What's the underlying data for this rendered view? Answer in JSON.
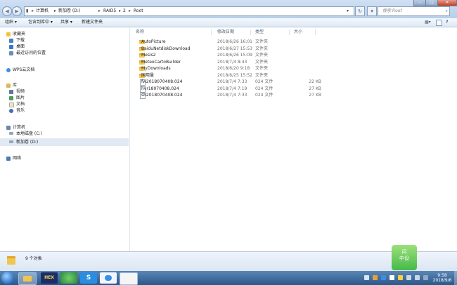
{
  "address": {
    "segments": [
      "计算机",
      "新加卷 (D:)",
      "RAID5",
      "2",
      "Root"
    ]
  },
  "search": {
    "placeholder": "搜索 Root"
  },
  "toolbar": {
    "organize": "组织 ▾",
    "include_in_library": "包含到库中 ▾",
    "share": "共享 ▾",
    "new_folder": "新建文件夹"
  },
  "nav": {
    "favorites": "收藏夹",
    "downloads": "下载",
    "desktop": "桌面",
    "recent": "最近访问的位置",
    "wps_cloud": "WPS云文档",
    "libraries": "库",
    "videos": "视频",
    "pictures": "图片",
    "documents": "文档",
    "music": "音乐",
    "computer": "计算机",
    "local_disk": "本地磁盘 (C:)",
    "new_volume": "新加卷 (D:)",
    "network": "网络"
  },
  "columns": {
    "name": "名称",
    "modified": "修改日期",
    "type": "类型",
    "size": "大小"
  },
  "files": [
    {
      "name": "AutoPicture",
      "modified": "2018/6/26 16:01",
      "type": "文件夹",
      "size": "",
      "kind": "folder"
    },
    {
      "name": "BaiduNetdiskDownload",
      "modified": "2018/6/27 15:53",
      "type": "文件夹",
      "size": "",
      "kind": "folder"
    },
    {
      "name": "Mesis2",
      "modified": "2018/6/26 15:09",
      "type": "文件夹",
      "size": "",
      "kind": "folder"
    },
    {
      "name": "MeteoCartoBuilder",
      "modified": "2018/7/4 8:43",
      "type": "文件夹",
      "size": "",
      "kind": "folder"
    },
    {
      "name": "MyDownloads",
      "modified": "2018/6/20 9:18",
      "type": "文件夹",
      "size": "",
      "kind": "folder"
    },
    {
      "name": "国用量",
      "modified": "2018/6/25 15:52",
      "type": "文件夹",
      "size": "",
      "kind": "folder"
    },
    {
      "name": "fw2018070408.024",
      "modified": "2018/7/4 7:33",
      "type": "024 文件",
      "size": "22 KB",
      "kind": "file"
    },
    {
      "name": "hvr18070408.024",
      "modified": "2018/7/4 7:19",
      "type": "024 文件",
      "size": "27 KB",
      "kind": "file"
    },
    {
      "name": "sh2018070408.024",
      "modified": "2018/7/4 7:33",
      "type": "024 文件",
      "size": "27 KB",
      "kind": "file"
    }
  ],
  "status": {
    "count": "9 个对象"
  },
  "watermark": {
    "text": "问\n中设"
  },
  "clock": {
    "time": "9:58",
    "date": "2018/9/6"
  },
  "taskbar": {
    "hex_label": "HEX"
  },
  "colors": {
    "accent": "#2c5789",
    "folder": "#f2c955",
    "selection": "#e5eef9"
  }
}
